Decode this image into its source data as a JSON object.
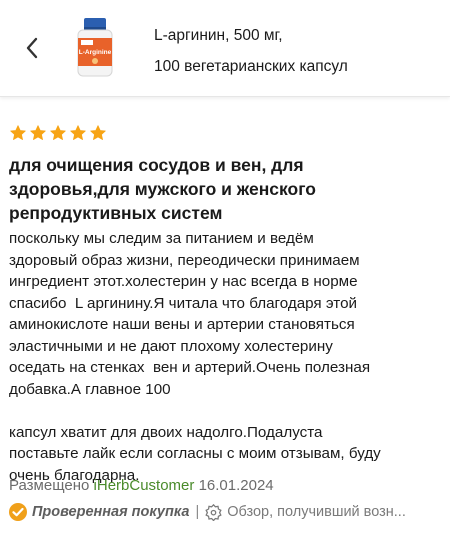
{
  "header": {
    "product_title_lines": [
      "L-аргинин, 500 мг,",
      "100 вегетарианских капсул"
    ],
    "product_label": "L-Arginine"
  },
  "review": {
    "rating": 5,
    "rating_max": 5,
    "star_color": "#f7a415",
    "title_lines": [
      "для очищения сосудов и вен, для",
      "здоровья,для мужского и женского",
      "репродуктивных систем"
    ],
    "body_lines": [
      "поскольку мы следим за питанием и ведём",
      "здоровый образ жизни, переодически принимаем",
      "ингредиент этот.холестерин у нас всегда в норме",
      "спасибо  L аргинину.Я читала что благодаря этой",
      "аминокислоте наши вены и артерии становяться",
      "эластичными и не дают плохому холестерину",
      "оседать на стенках  вен и артерий.Очень полезная",
      "добавка.А главное 100",
      "",
      "капсул хватит для двоих надолго.Подалуста",
      "поставьте лайк если согласны с моим отзывам, буду",
      "очень благодарна."
    ],
    "posted_prefix": "Размещено",
    "author": "iHerbCustomer",
    "date": "16.01.2024",
    "verified_label": "Проверенная покупка",
    "separator": "|",
    "incentive_label": "Обзор, получивший возн..."
  },
  "colors": {
    "verified_icon": "#f0a01a",
    "author_link": "#4a8b2b",
    "bottle_cap": "#2b5fb0",
    "bottle_label": "#e8622a"
  }
}
